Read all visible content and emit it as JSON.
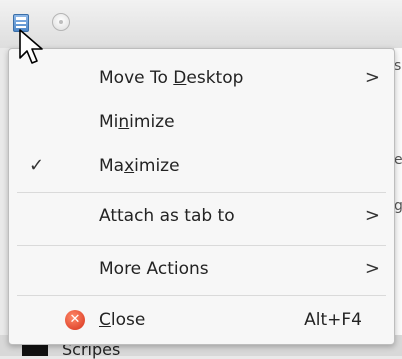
{
  "menu": {
    "items": [
      {
        "pre": "Move To ",
        "ul": "D",
        "post": "esktop",
        "submenu": ">"
      },
      {
        "pre": "Mi",
        "ul": "n",
        "post": "imize"
      },
      {
        "pre": "Ma",
        "ul": "x",
        "post": "imize",
        "check": "✓"
      },
      {
        "pre": "",
        "ul": "",
        "post": "Attach as tab to",
        "submenu": ">"
      },
      {
        "pre": "",
        "ul": "",
        "post": "More Actions",
        "submenu": ">"
      },
      {
        "pre": "",
        "ul": "C",
        "post": "lose",
        "shortcut": "Alt+F4"
      }
    ]
  },
  "background": {
    "bottom_text": "Scripes",
    "side_letters": [
      "s",
      "e",
      "g"
    ]
  },
  "icons": {
    "close": "close-icon",
    "app": "app-menu-icon",
    "cursor": "mouse-cursor-icon"
  },
  "colors": {
    "close_icon": "#d6301a",
    "app_icon": "#4e87c8"
  }
}
